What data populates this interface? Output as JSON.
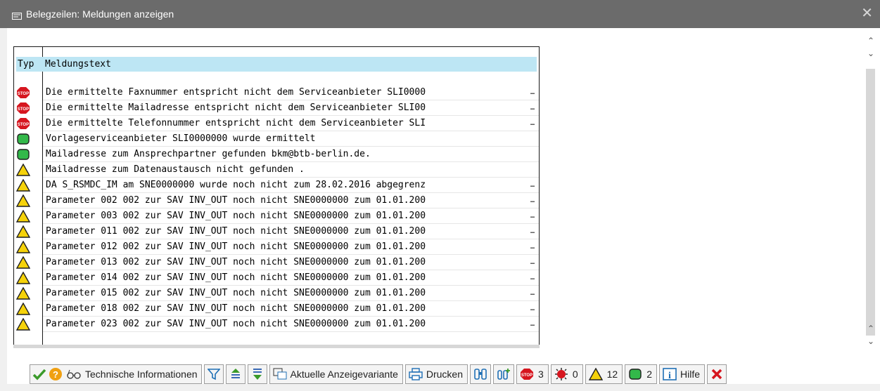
{
  "window": {
    "title": "Belegzeilen: Meldungen anzeigen",
    "close_glyph": "✕"
  },
  "grid": {
    "col_typ": "Typ",
    "col_text": "Meldungstext",
    "rows": [
      {
        "type": "error",
        "icon": "stop-icon",
        "text": "Die ermittelte Faxnummer entspricht nicht dem Serviceanbieter SLI0000"
      },
      {
        "type": "error",
        "icon": "stop-icon",
        "text": "Die ermittelte Mailadresse entspricht nicht dem Serviceanbieter SLI00"
      },
      {
        "type": "error",
        "icon": "stop-icon",
        "text": "Die ermittelte Telefonnummer entspricht nicht dem Serviceanbieter SLI"
      },
      {
        "type": "success",
        "icon": "green-square-icon",
        "text": "Vorlageserviceanbieter SLI0000000 wurde ermittelt"
      },
      {
        "type": "success",
        "icon": "green-square-icon",
        "text": "Mailadresse zum Ansprechpartner  gefunden bkm@btb-berlin.de."
      },
      {
        "type": "warning",
        "icon": "warning-triangle-icon",
        "text": "Mailadresse zum Datenaustausch nicht gefunden ."
      },
      {
        "type": "warning",
        "icon": "warning-triangle-icon",
        "text": "DA S_RSMDC_IM am SNE0000000 wurde noch nicht zum 28.02.2016 abgegrenz"
      },
      {
        "type": "warning",
        "icon": "warning-triangle-icon",
        "text": "Parameter 002 002 zur SAV INV_OUT noch nicht SNE0000000 zum 01.01.200"
      },
      {
        "type": "warning",
        "icon": "warning-triangle-icon",
        "text": "Parameter 003 002 zur SAV INV_OUT noch nicht SNE0000000 zum 01.01.200"
      },
      {
        "type": "warning",
        "icon": "warning-triangle-icon",
        "text": "Parameter 011 002 zur SAV INV_OUT noch nicht SNE0000000 zum 01.01.200"
      },
      {
        "type": "warning",
        "icon": "warning-triangle-icon",
        "text": "Parameter 012 002 zur SAV INV_OUT noch nicht SNE0000000 zum 01.01.200"
      },
      {
        "type": "warning",
        "icon": "warning-triangle-icon",
        "text": "Parameter 013 002 zur SAV INV_OUT noch nicht SNE0000000 zum 01.01.200"
      },
      {
        "type": "warning",
        "icon": "warning-triangle-icon",
        "text": "Parameter 014 002 zur SAV INV_OUT noch nicht SNE0000000 zum 01.01.200"
      },
      {
        "type": "warning",
        "icon": "warning-triangle-icon",
        "text": "Parameter 015 002 zur SAV INV_OUT noch nicht SNE0000000 zum 01.01.200"
      },
      {
        "type": "warning",
        "icon": "warning-triangle-icon",
        "text": "Parameter 018 002 zur SAV INV_OUT noch nicht SNE0000000 zum 01.01.200"
      },
      {
        "type": "warning",
        "icon": "warning-triangle-icon",
        "text": "Parameter 023 002 zur SAV INV_OUT noch nicht SNE0000000 zum 01.01.200"
      }
    ]
  },
  "toolbar": {
    "tech_info_label": "Technische Informationen",
    "variant_label": "Aktuelle Anzeigevariante",
    "print_label": "Drucken",
    "error_count": "3",
    "abort_count": "0",
    "warning_count": "12",
    "success_count": "2",
    "help_label": "Hilfe"
  },
  "colors": {
    "titlebar": "#6b6b6b",
    "header_row": "#bde6f4",
    "error": "#d6161f",
    "warning": "#f5d20a",
    "success": "#33b84a",
    "accent_blue": "#1f6fb5"
  }
}
